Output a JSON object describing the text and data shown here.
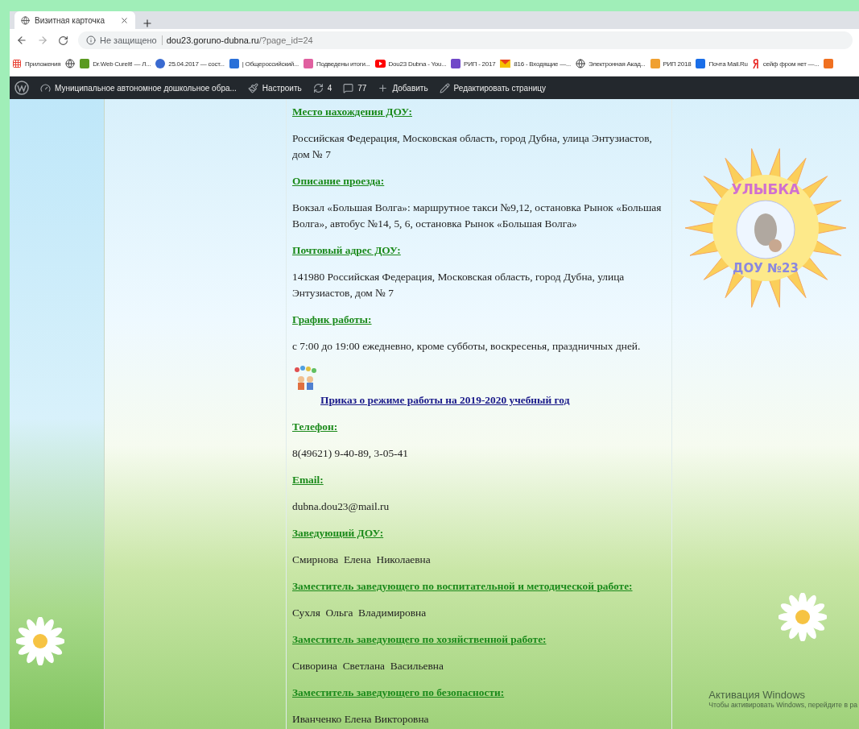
{
  "browser": {
    "tab": {
      "title": "Визитная карточка",
      "selected": true
    },
    "address": {
      "security": "Не защищено",
      "host": "dou23.goruno-dubna.ru",
      "path": "/?page_id=24"
    },
    "bookmarks": [
      {
        "kind": "apps",
        "label": "Приложения"
      },
      {
        "kind": "globe"
      },
      {
        "kind": "square",
        "color": "#5a9a20",
        "label": "Dr.Web CureIt! — Л..."
      },
      {
        "kind": "circle",
        "color": "#3a6ad0",
        "label": "25.04.2017 — сост..."
      },
      {
        "kind": "square",
        "color": "#2a70d8",
        "label": "| Общероссийский..."
      },
      {
        "kind": "square",
        "color": "#e060a0",
        "label": "Подведены итоги..."
      },
      {
        "kind": "play",
        "color": "#ff0000",
        "label": "Dou23 Dubna - You..."
      },
      {
        "kind": "square",
        "color": "#7048c8",
        "label": "РИП - 2017"
      },
      {
        "kind": "mail",
        "color": "#f5c000",
        "label": "816 - Входящие —..."
      },
      {
        "kind": "globe",
        "label": "Электронная Акад..."
      },
      {
        "kind": "square",
        "color": "#f0a030",
        "label": "РИП 2018"
      },
      {
        "kind": "square",
        "color": "#1a6ee8",
        "label": "Почта Mail.Ru"
      },
      {
        "kind": "letter",
        "color": "#e8201c",
        "label": "сейф фром нет —..."
      },
      {
        "kind": "square",
        "color": "#f07020"
      }
    ]
  },
  "admin_bar": [
    {
      "kind": "logo"
    },
    {
      "kind": "site",
      "label": "Муниципальное автономное дошкольное обра..."
    },
    {
      "kind": "customize",
      "label": "Настроить"
    },
    {
      "kind": "updates",
      "label": "4"
    },
    {
      "kind": "comments",
      "label": "77"
    },
    {
      "kind": "add",
      "label": "Добавить"
    },
    {
      "kind": "edit",
      "label": "Редактировать страницу"
    }
  ],
  "content": [
    {
      "kind": "field",
      "heading": "Место нахождения ДОУ:",
      "value": "Российская Федерация, Московская область, город Дубна, улица Энтузиастов, дом № 7"
    },
    {
      "kind": "field",
      "heading": "Описание проезда:",
      "value": "Вокзал «Большая Волга»: маршрутное такси №9,12, остановка Рынок «Большая Волга», автобус №14, 5, 6, остановка Рынок «Большая Волга»"
    },
    {
      "kind": "field",
      "heading": "Почтовый адрес ДОУ:",
      "value": "141980 Российская Федерация, Московская область, город Дубна, улица Энтузиастов, дом № 7"
    },
    {
      "kind": "field",
      "heading": "График работы:",
      "value": "с 7:00 до 19:00 ежедневно, кроме субботы, воскресенья, праздничных дней."
    },
    {
      "kind": "link",
      "text": "Приказ о режиме работы на 2019-2020 учебный год"
    },
    {
      "kind": "field",
      "heading": "Телефон:",
      "value": "8(49621) 9-40-89, 3-05-41"
    },
    {
      "kind": "field",
      "heading": "Email:",
      "value": "dubna.dou23@mail.ru"
    },
    {
      "kind": "field",
      "heading": "Заведующий ДОУ:",
      "value": "Смирнова  Елена  Николаевна"
    },
    {
      "kind": "field",
      "heading": "Заместитель заведующего по воспитательной и методической работе:",
      "value": "Сухля  Ольга  Владимировна"
    },
    {
      "kind": "field",
      "heading": "Заместитель заведующего по хозяйственной работе:",
      "value": "Сиворина  Светлана  Васильевна"
    },
    {
      "kind": "field",
      "heading": "Заместитель заведующего по безопасности:",
      "value": "Иванченко Елена Викторовна"
    }
  ],
  "logo": {
    "top_text": "УЛЫБКА",
    "bottom_text": "ДОУ №23"
  },
  "os_overlay": {
    "title": "Активация Windows",
    "text": "Чтобы активировать Windows, перейдите в ра"
  }
}
